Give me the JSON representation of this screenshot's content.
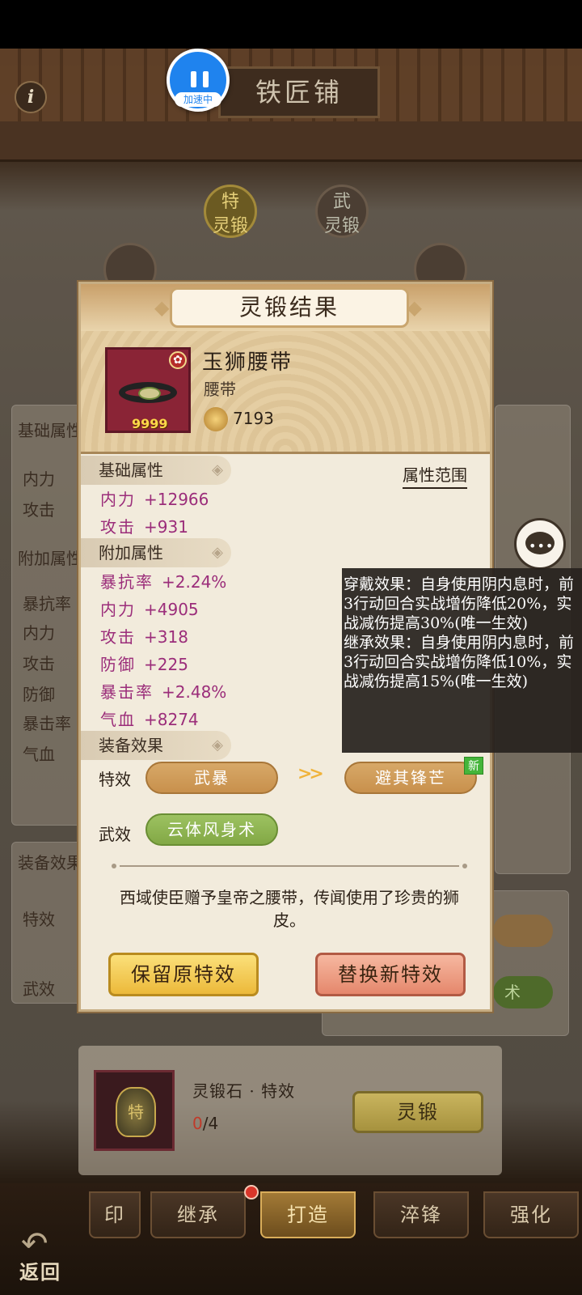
{
  "header": {
    "title": "铁匠铺",
    "info_glyph": "i",
    "speed_label": "加速中"
  },
  "background": {
    "tabs_top": [
      "特\n灵锻",
      "武\n灵锻"
    ],
    "base_attrs_label": "基础属性",
    "base_stats": [
      "内力",
      "攻击"
    ],
    "extra_attrs_label": "附加属性",
    "extra_stats": [
      "暴抗率",
      "内力",
      "攻击",
      "防御",
      "暴击率",
      "气血"
    ],
    "equip_effects_label": "装备效果",
    "teffect_label": "特效",
    "weffect_label": "武效",
    "right_partial": "术"
  },
  "modal": {
    "title": "灵锻结果",
    "item": {
      "name": "玉狮腰带",
      "type": "腰带",
      "count": "9999",
      "badge_icon": "flower-badge-icon",
      "power": "7193"
    },
    "base_section": "基础属性",
    "range_link": "属性范围",
    "base_stats": [
      {
        "k": "内力",
        "v": "+12966"
      },
      {
        "k": "攻击",
        "v": "+931"
      }
    ],
    "extra_section": "附加属性",
    "extra_stats": [
      {
        "k": "暴抗率",
        "v": "+2.24%"
      },
      {
        "k": "内力",
        "v": "+4905"
      },
      {
        "k": "攻击",
        "v": "+318"
      },
      {
        "k": "防御",
        "v": "+225"
      },
      {
        "k": "暴击率",
        "v": "+2.48%"
      },
      {
        "k": "气血",
        "v": "+8274"
      }
    ],
    "effect_section": "装备效果",
    "special_label": "特效",
    "special_old": "武暴",
    "special_new": "避其锋芒",
    "arrow": ">>",
    "new_tag": "新",
    "martial_label": "武效",
    "martial_value": "云体风身术",
    "description": "西域使臣赠予皇帝之腰带，传闻使用了珍贵的狮皮。",
    "keep_button": "保留原特效",
    "replace_button": "替换新特效"
  },
  "tooltip": {
    "wear_effect": "穿戴效果：自身使用阴内息时，前3行动回合实战增伤降低20%，实战减伤提高30%(唯一生效)",
    "inherit_effect": "继承效果：自身使用阴内息时，前3行动回合实战增伤降低10%，实战减伤提高15%(唯一生效)"
  },
  "material": {
    "name": "灵锻石 · 特效",
    "icon_glyph": "特",
    "current": "0",
    "total": "/4",
    "forge_button": "灵锻"
  },
  "tabbar": {
    "tabs": [
      "印",
      "继承",
      "打造",
      "淬锋",
      "强化"
    ],
    "back_label": "返回",
    "back_glyph": "↶"
  },
  "colors": {
    "stat_purple": "#9b2d7a",
    "gold_pill": "#d7a868",
    "green_pill": "#9dc261",
    "speed_blue": "#1f83ee"
  }
}
